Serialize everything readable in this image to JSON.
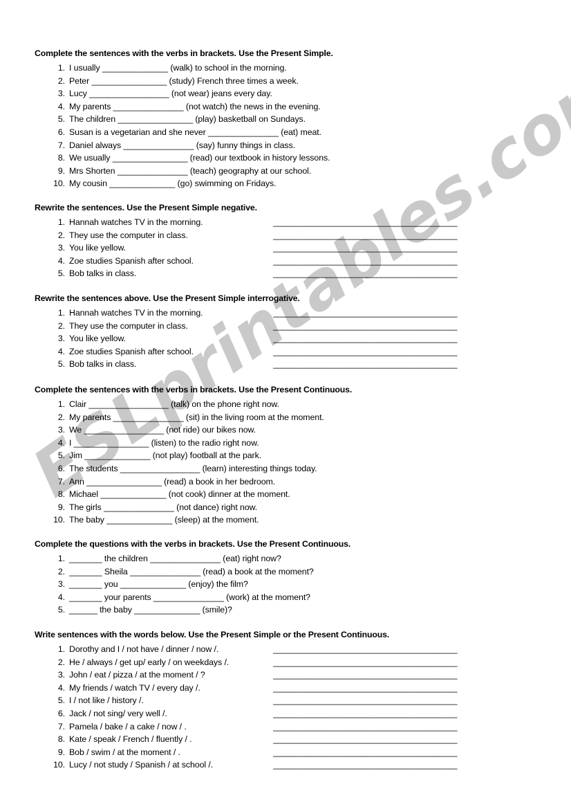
{
  "watermark": {
    "text": "ESLprintables.com",
    "color": "#c9c9c9"
  },
  "sections": [
    {
      "id": "present-simple-complete",
      "heading": "Complete the sentences with the verbs in brackets. Use the Present Simple.",
      "has_answer_lines": false,
      "items": [
        {
          "n": "1.",
          "text": "I usually ______________ (walk) to school in the morning."
        },
        {
          "n": "2.",
          "text": "Peter ________________ (study) French three times a week."
        },
        {
          "n": "3.",
          "text": "Lucy _________________ (not wear) jeans every day."
        },
        {
          "n": "4.",
          "text": "My parents _______________ (not watch) the news in the evening."
        },
        {
          "n": "5.",
          "text": "The children ________________ (play) basketball on Sundays."
        },
        {
          "n": "6.",
          "text": "Susan is a vegetarian and she never _______________ (eat) meat."
        },
        {
          "n": "7.",
          "text": "Daniel always _______________ (say) funny things in class."
        },
        {
          "n": "8.",
          "text": "We usually ________________ (read) our textbook in history lessons."
        },
        {
          "n": "9.",
          "text": "Mrs Shorten _______________ (teach) geography at our school."
        },
        {
          "n": "10.",
          "text": "My cousin ______________ (go) swimming on Fridays."
        }
      ]
    },
    {
      "id": "present-simple-negative",
      "heading": "Rewrite the sentences. Use the Present Simple negative.",
      "has_answer_lines": true,
      "items": [
        {
          "n": "1.",
          "text": "Hannah watches TV in the morning.",
          "line": "_________________________________________"
        },
        {
          "n": "2.",
          "text": "They use the computer in class.",
          "line": "_________________________________________"
        },
        {
          "n": "3.",
          "text": "You like yellow.",
          "line": "_________________________________________"
        },
        {
          "n": "4.",
          "text": "Zoe studies Spanish after school.",
          "line": "_________________________________________"
        },
        {
          "n": "5.",
          "text": "Bob talks in class.",
          "line": "_________________________________________"
        }
      ]
    },
    {
      "id": "present-simple-interrogative",
      "heading": "Rewrite the sentences above. Use the Present Simple interrogative.",
      "has_answer_lines": true,
      "items": [
        {
          "n": "1.",
          "text": "Hannah watches TV in the morning.",
          "line": "_________________________________________"
        },
        {
          "n": "2.",
          "text": "They use the computer in class.",
          "line": "_________________________________________"
        },
        {
          "n": "3.",
          "text": "You like yellow.",
          "line": "_________________________________________"
        },
        {
          "n": "4.",
          "text": "Zoe studies Spanish after school.",
          "line": "_________________________________________"
        },
        {
          "n": "5.",
          "text": "Bob talks in class.",
          "line": "_________________________________________"
        }
      ]
    },
    {
      "id": "present-continuous-complete",
      "heading": "Complete the sentences with the verbs in brackets. Use the Present Continuous.",
      "has_answer_lines": false,
      "items": [
        {
          "n": "1.",
          "text": "Clair _________________ (talk) on the phone right now."
        },
        {
          "n": "2.",
          "text": "My parents _______________ (sit) in the living room at the moment."
        },
        {
          "n": "3.",
          "text": "We _________________ (not ride) our bikes now."
        },
        {
          "n": "4.",
          "text": "I ________________ (listen) to the radio right now."
        },
        {
          "n": "5.",
          "text": "Jim ______________ (not play) football at the park."
        },
        {
          "n": "6.",
          "text": "The students _________________ (learn) interesting things today."
        },
        {
          "n": "7.",
          "text": "Ann ________________ (read) a book in her bedroom."
        },
        {
          "n": "8.",
          "text": "Michael ______________ (not cook) dinner at the moment."
        },
        {
          "n": "9.",
          "text": "The girls _______________ (not dance) right now."
        },
        {
          "n": "10.",
          "text": "The baby ______________ (sleep) at the moment."
        }
      ]
    },
    {
      "id": "present-continuous-questions",
      "heading": "Complete the questions with the verbs in brackets. Use the Present Continuous.",
      "has_answer_lines": false,
      "items": [
        {
          "n": "1.",
          "text": "_______ the children _______________ (eat) right now?"
        },
        {
          "n": "2.",
          "text": "_______ Sheila _______________ (read) a book at the moment?"
        },
        {
          "n": "3.",
          "text": "_______ you ______________ (enjoy) the film?"
        },
        {
          "n": "4.",
          "text": "_______ your parents _______________ (work) at the moment?"
        },
        {
          "n": "5.",
          "text": "______ the baby ______________ (smile)?"
        }
      ]
    },
    {
      "id": "write-sentences",
      "heading": "Write sentences with the words below. Use the Present Simple or the Present Continuous.",
      "has_answer_lines": true,
      "items": [
        {
          "n": "1.",
          "text": "Dorothy and I / not have / dinner / now /.",
          "line": "_________________________________________"
        },
        {
          "n": "2.",
          "text": "He / always / get up/ early / on weekdays /.",
          "line": "_________________________________________"
        },
        {
          "n": "3.",
          "text": "John / eat / pizza / at the moment / ?",
          "line": "_________________________________________"
        },
        {
          "n": "4.",
          "text": "My friends / watch TV / every day /.",
          "line": "_________________________________________"
        },
        {
          "n": "5.",
          "text": "I / not like / history /.",
          "line": "_________________________________________"
        },
        {
          "n": "6.",
          "text": "Jack / not sing/ very well /.",
          "line": "_________________________________________"
        },
        {
          "n": "7.",
          "text": "Pamela / bake / a cake / now / .",
          "line": "_________________________________________"
        },
        {
          "n": "8.",
          "text": "Kate / speak / French / fluently / .",
          "line": "_________________________________________"
        },
        {
          "n": "9.",
          "text": "Bob / swim / at the moment / .",
          "line": "_________________________________________"
        },
        {
          "n": "10.",
          "text": "Lucy / not study / Spanish / at school /.",
          "line": "_________________________________________"
        }
      ]
    }
  ],
  "layout": {
    "section_tops": [
      70,
      293,
      424,
      556,
      779,
      910
    ]
  }
}
